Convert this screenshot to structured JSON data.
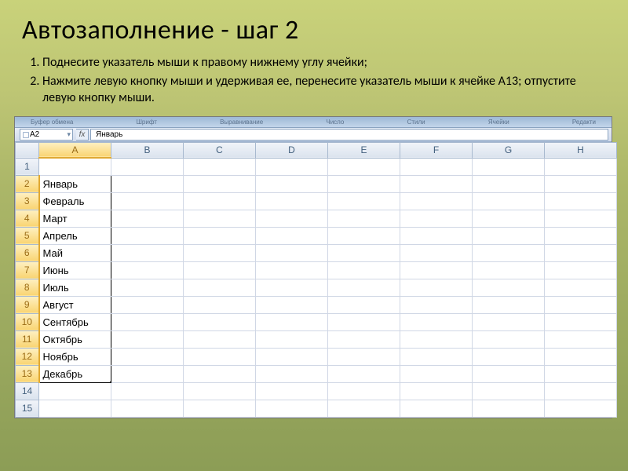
{
  "title": "Автозаполнение - шаг 2",
  "steps": [
    "Поднесите указатель мыши к правому нижнему углу ячейки;",
    "Нажмите левую кнопку мыши и удерживая ее, перенесите указатель мыши к ячейке А13; отпустите левую кнопку мыши."
  ],
  "ribbon": {
    "left_groups": [
      "Буфер обмена",
      "Шрифт",
      "Выравнивание",
      "Число"
    ],
    "right_groups": [
      "Стили",
      "Ячейки",
      "Редакти"
    ]
  },
  "name_box": "A2",
  "fx_label": "fx",
  "formula_value": "Январь",
  "columns": [
    "A",
    "B",
    "C",
    "D",
    "E",
    "F",
    "G",
    "H"
  ],
  "selected_column": "A",
  "row_count": 15,
  "selected_rows_from": 2,
  "selected_rows_to": 13,
  "cell_values": {
    "A2": "Январь",
    "A3": "Февраль",
    "A4": "Март",
    "A5": "Апрель",
    "A6": "Май",
    "A7": "Июнь",
    "A8": "Июль",
    "A9": "Август",
    "A10": "Сентябрь",
    "A11": "Октябрь",
    "A12": "Ноябрь",
    "A13": "Декабрь"
  },
  "autofill_icon": "⬚"
}
